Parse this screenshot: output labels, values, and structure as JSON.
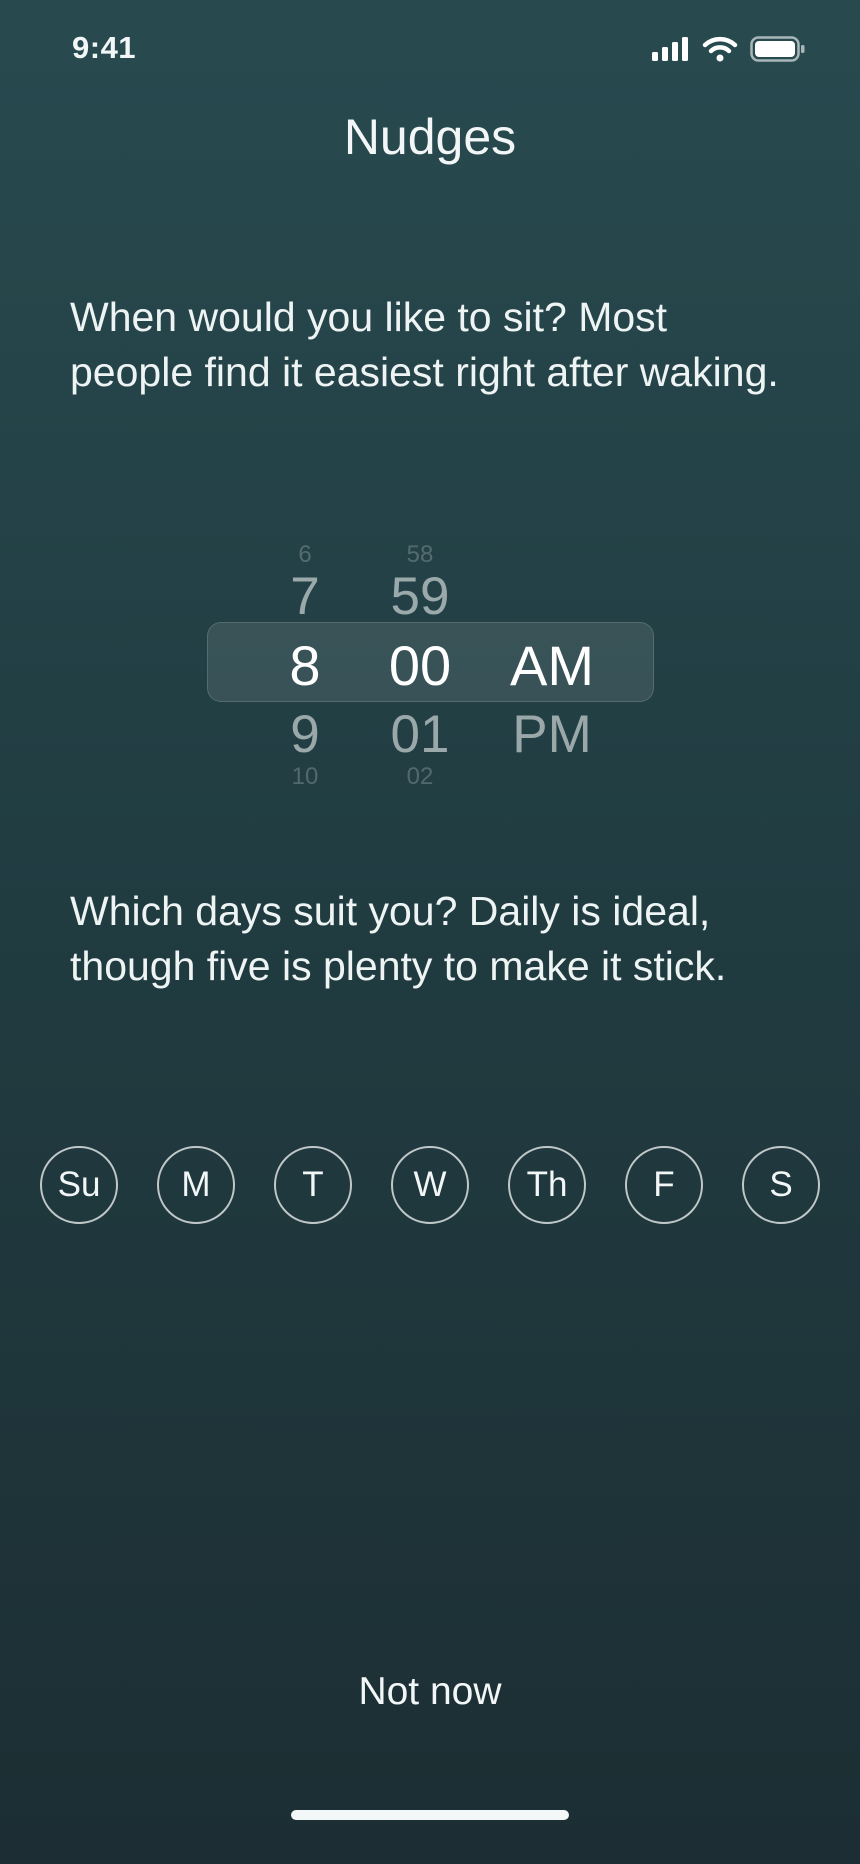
{
  "status_bar": {
    "time": "9:41",
    "icons": [
      "signal-icon",
      "wifi-icon",
      "battery-icon"
    ]
  },
  "header": {
    "title": "Nudges"
  },
  "time_section": {
    "prompt": "When would you like to sit? Most people find it easiest right after waking."
  },
  "time_picker": {
    "hour": {
      "far_above": "6",
      "above": "7",
      "selected": "8",
      "below": "9",
      "far_below": "10"
    },
    "minute": {
      "far_above": "58",
      "above": "59",
      "selected": "00",
      "below": "01",
      "far_below": "02"
    },
    "period": {
      "selected": "AM",
      "below": "PM"
    }
  },
  "days_section": {
    "prompt": "Which days suit you? Daily is ideal, though five is plenty to make it stick.",
    "days": [
      "Su",
      "M",
      "T",
      "W",
      "Th",
      "F",
      "S"
    ]
  },
  "footer": {
    "not_now_label": "Not now"
  },
  "colors": {
    "background_top": "#284a4f",
    "background_bottom": "#1c2e33",
    "text": "#f2f6f6"
  }
}
